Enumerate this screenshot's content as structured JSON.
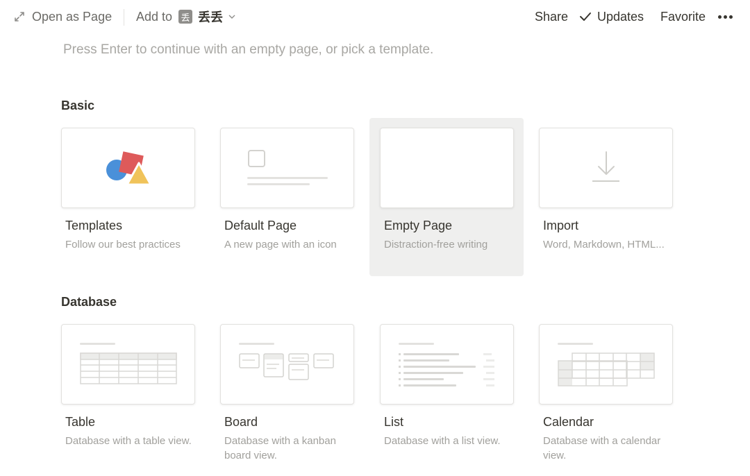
{
  "topbar": {
    "open_as_page": "Open as Page",
    "add_to": "Add to",
    "workspace_badge": "丢",
    "workspace_name": "丢丢",
    "share": "Share",
    "updates": "Updates",
    "favorite": "Favorite"
  },
  "hint": "Press Enter to continue with an empty page, or pick a template.",
  "sections": {
    "basic": {
      "title": "Basic",
      "cards": [
        {
          "title": "Templates",
          "desc": "Follow our best practices"
        },
        {
          "title": "Default Page",
          "desc": "A new page with an icon"
        },
        {
          "title": "Empty Page",
          "desc": "Distraction-free writing"
        },
        {
          "title": "Import",
          "desc": "Word, Markdown, HTML..."
        }
      ]
    },
    "database": {
      "title": "Database",
      "cards": [
        {
          "title": "Table",
          "desc": "Database with a table view."
        },
        {
          "title": "Board",
          "desc": "Database with a kanban board view."
        },
        {
          "title": "List",
          "desc": "Database with a list view."
        },
        {
          "title": "Calendar",
          "desc": "Database with a calendar view."
        }
      ]
    }
  },
  "colors": {
    "text": "#37352f",
    "muted": "#a1a09c",
    "template_red": "#de5a5a",
    "template_blue": "#4a90d9",
    "template_yellow": "#f0c35a",
    "selected_bg": "#efefee"
  },
  "icons": {
    "open_as_page": "expand-arrows-icon",
    "workspace_dropdown": "chevron-down-icon",
    "updates": "checkmark-icon",
    "more": "more-horizontal-icon",
    "import": "download-arrow-icon"
  }
}
